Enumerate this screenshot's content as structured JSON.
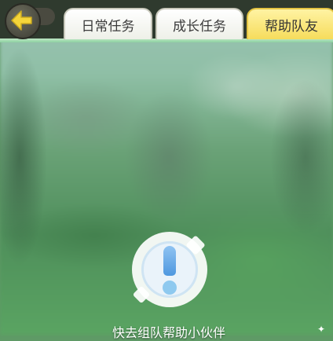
{
  "header": {
    "back_icon": "arrow-left-icon",
    "tabs": [
      {
        "label": "日常任务",
        "active": false
      },
      {
        "label": "成长任务",
        "active": false
      },
      {
        "label": "帮助队友",
        "active": true
      }
    ]
  },
  "empty_state": {
    "icon": "exclamation-icon",
    "message": "快去组队帮助小伙伴"
  },
  "colors": {
    "active_tab": "#f6dc5c",
    "header_bg": "#2f3a2e",
    "arrow": "#f5d53a"
  }
}
